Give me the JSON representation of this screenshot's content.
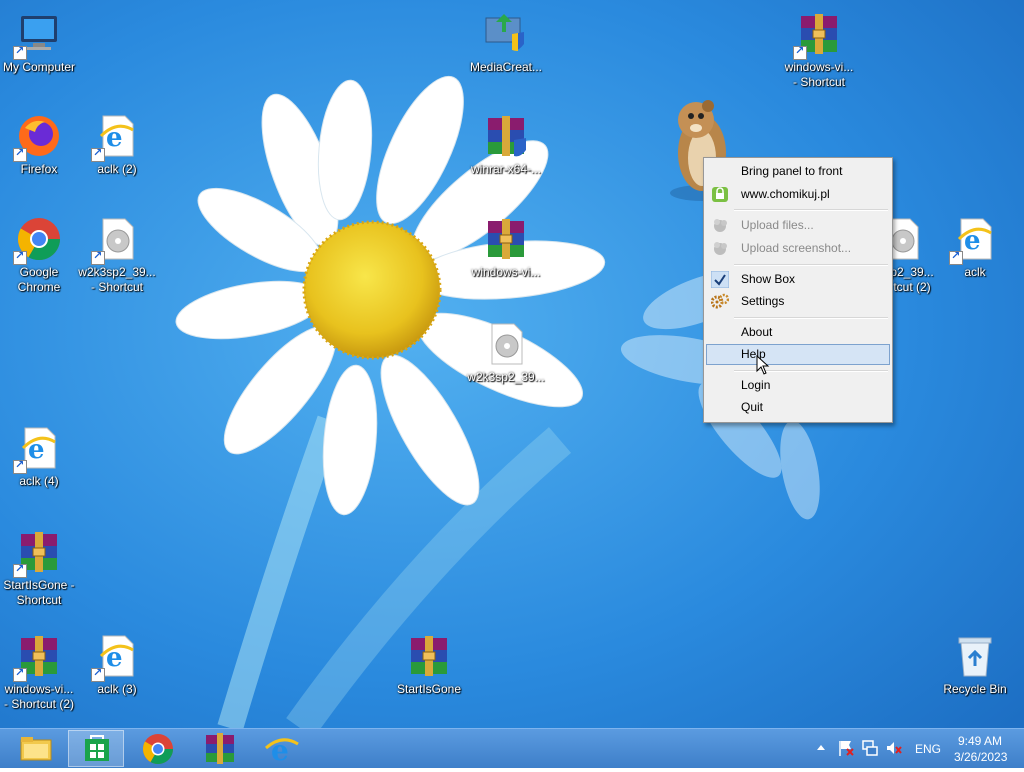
{
  "desktop": {
    "icons": [
      {
        "label_lines": [
          "My Computer"
        ]
      },
      {
        "label_lines": [
          "Firefox"
        ]
      },
      {
        "label_lines": [
          "aclk (2)"
        ]
      },
      {
        "label_lines": [
          "Google",
          "Chrome"
        ]
      },
      {
        "label_lines": [
          "w2k3sp2_39...",
          "- Shortcut"
        ]
      },
      {
        "label_lines": [
          "aclk (4)"
        ]
      },
      {
        "label_lines": [
          "StartIsGone -",
          "Shortcut"
        ]
      },
      {
        "label_lines": [
          "windows-vi...",
          "- Shortcut (2)"
        ]
      },
      {
        "label_lines": [
          "aclk (3)"
        ]
      },
      {
        "label_lines": [
          "MediaCreat..."
        ]
      },
      {
        "label_lines": [
          "winrar-x64-..."
        ]
      },
      {
        "label_lines": [
          "windows-vi..."
        ]
      },
      {
        "label_lines": [
          "w2k3sp2_39..."
        ]
      },
      {
        "label_lines": [
          "StartIsGone"
        ]
      },
      {
        "label_lines": [
          "windows-vi...",
          "- Shortcut"
        ]
      },
      {
        "label_lines": [
          "p2_39...",
          "tcut (2)"
        ]
      },
      {
        "label_lines": [
          "aclk"
        ]
      },
      {
        "label_lines": [
          "Recycle Bin"
        ]
      }
    ]
  },
  "context_menu": {
    "items": [
      {
        "label": "Bring panel to front",
        "enabled": true
      },
      {
        "label": "www.chomikuj.pl",
        "enabled": true,
        "icon": "home-lock-icon"
      },
      {
        "label": "Upload files...",
        "enabled": false,
        "icon": "upload-files-icon"
      },
      {
        "label": "Upload screenshot...",
        "enabled": false,
        "icon": "upload-screenshot-icon"
      },
      {
        "label": "Show Box",
        "enabled": true,
        "checked": true
      },
      {
        "label": "Settings",
        "enabled": true,
        "icon": "settings-gears-icon"
      },
      {
        "label": "About",
        "enabled": true
      },
      {
        "label": "Help",
        "enabled": true,
        "highlighted": true
      },
      {
        "label": "Login",
        "enabled": true
      },
      {
        "label": "Quit",
        "enabled": true
      }
    ]
  },
  "taskbar": {
    "apps": [
      "file-explorer-icon",
      "store-icon",
      "chrome-icon",
      "winrar-icon",
      "internet-explorer-icon"
    ],
    "tray": {
      "language": "ENG",
      "time": "9:49 AM",
      "date": "3/26/2023"
    }
  },
  "colors": {
    "accent": "#3e7fc9",
    "menu_highlight": "#d5e4f5"
  }
}
